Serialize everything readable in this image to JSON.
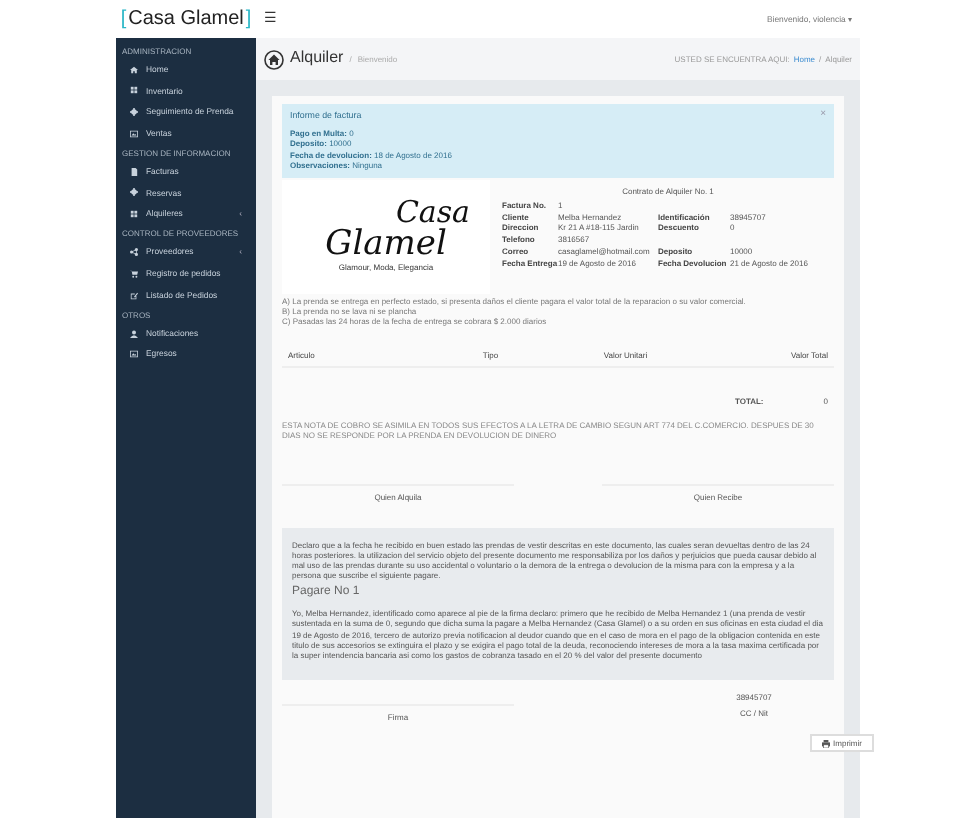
{
  "brand": {
    "bracket_left": "[",
    "name": "Casa Glamel",
    "bracket_right": "]"
  },
  "topbar": {
    "menu_glyph": "☰",
    "user": "Bienvenido, violencia",
    "caret": "▾"
  },
  "sidebar": {
    "sections": [
      {
        "title": "ADMINISTRACION",
        "items": [
          {
            "label": "Home"
          },
          {
            "label": "Inventario"
          },
          {
            "label": "Seguimiento de Prenda"
          },
          {
            "label": "Ventas"
          }
        ]
      },
      {
        "title": "GESTION DE INFORMACION",
        "items": [
          {
            "label": "Facturas"
          },
          {
            "label": "Reservas"
          },
          {
            "label": "Alquileres",
            "chevron": "‹"
          }
        ]
      },
      {
        "title": "CONTROL DE PROVEEDORES",
        "items": [
          {
            "label": "Proveedores",
            "chevron": "‹"
          },
          {
            "label": "Registro de pedidos"
          },
          {
            "label": "Listado de Pedidos"
          }
        ]
      },
      {
        "title": "OTROS",
        "items": [
          {
            "label": "Notificaciones"
          },
          {
            "label": "Egresos"
          }
        ]
      }
    ]
  },
  "header": {
    "title": "Alquiler",
    "separator": "/",
    "subtitle": "Bienvenido",
    "breadcrumb_label": "USTED SE ENCUENTRA AQUI:",
    "breadcrumb": [
      "Home",
      "Alquiler"
    ]
  },
  "alert": {
    "title": "Informe de factura",
    "close": "×",
    "lines": [
      "**Pago en Multa:** 0",
      "**Deposito:** 10000",
      "**Fecha de devolucion:** 18 de Agosto de 2016",
      "**Observaciones:** Ninguna"
    ]
  },
  "logo": {
    "word_1": "Casa",
    "word_2": "Glamel",
    "tagline": "Glamour, Moda, Elegancia"
  },
  "contract": {
    "title": "Contrato de Alquiler No. 1",
    "rows": [
      [
        {
          "label": "Factura No.",
          "value": "1"
        }
      ],
      [
        {
          "label": "Cliente",
          "value": "Melba Hernandez"
        },
        {
          "label": "Identificación",
          "value": "38945707"
        }
      ],
      [
        {
          "label": "Direccion",
          "value": "Kr 21 A #18-115 Jardin"
        },
        {
          "label": "Descuento",
          "value": "0"
        }
      ],
      [
        {
          "label": "Telefono",
          "value": "3816567"
        }
      ],
      [
        {
          "label": "Correo",
          "value": "casaglamel@hotmail.com"
        },
        {
          "label": "Deposito",
          "value": "10000"
        }
      ],
      [
        {
          "label": "Fecha Entrega",
          "value": "19 de Agosto de 2016"
        },
        {
          "label": "Fecha Devolucion",
          "value": "21 de Agosto de 2016"
        }
      ]
    ]
  },
  "notes": [
    "A) La prenda se entrega en perfecto estado, si presenta daños el cliente pagara el valor total de la reparacion o su valor comercial.",
    "B) La prenda no se lava ni se plancha",
    "C) Pasadas las 24 horas de la fecha de entrega se cobrara $ 2.000 diarios"
  ],
  "table": {
    "columns": [
      "Articulo",
      "Tipo",
      "Valor Unitari",
      "Valor Total"
    ],
    "total_label": "TOTAL:",
    "total": "0"
  },
  "legal_note": "ESTA NOTA DE COBRO SE ASIMILA EN TODOS SUS EFECTOS A LA LETRA DE CAMBIO SEGUN ART 774 DEL C.COMERCIO. DESPUES DE 30 DIAS NO SE RESPONDE POR LA PRENDA EN DEVOLUCION DE DINERO",
  "signatures": [
    "Quien Alquila",
    "Quien Recibe"
  ],
  "declaration": {
    "text": "Declaro que a la fecha he recibido en buen estado las prendas de vestir descritas en este documento, las cuales seran devueltas dentro de las 24 horas posteriores. la utilizacion del servicio objeto del presente documento me responsabiliza por los daños y perjuicios que pueda causar debido al mal uso de las prendas durante su uso accidental o voluntario o la demora de la entrega o devolucion de la misma para con la empresa y a la persona que suscribe el siguiente pagare.",
    "heading": "Pagare No 1",
    "body": "Yo, Melba Hernandez, identificado como aparece al pie de la firma declaro: primero que he recibido de Melba Hernandez 1 (una prenda de vestir sustentada en la suma de 0, segundo que dicha suma la pagare a Melba Hernandez (Casa Glamel) o a su orden en sus oficinas en esta ciudad el dia 19 de Agosto de 2016, tercero de autorizo previa notificacion al deudor cuando que en el caso de mora en el pago de la obligacion contenida en este titulo de sus accesorios se extinguira el plazo y se exigira el pago total de la deuda, reconociendo intereses de mora a la tasa maxima certificada por la super intendencia bancaria asi como los gastos de cobranza tasado en el 20 % del valor del presente documento"
  },
  "footer": {
    "signature": "Firma",
    "id_number": "38945707",
    "id_label": "CC / Nit",
    "print_button": "Imprimir"
  }
}
